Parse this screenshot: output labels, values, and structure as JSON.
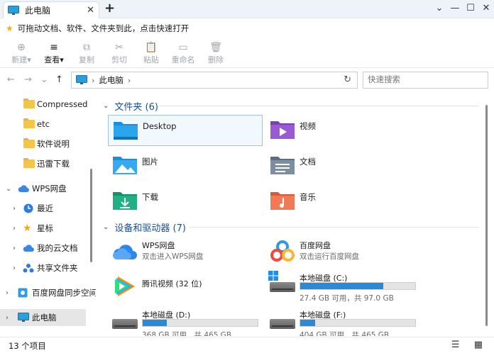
{
  "titlebar": {
    "tab_title": "此电脑",
    "close_glyph": "✕",
    "newtab_glyph": "+",
    "win_buttons": [
      "⌄",
      "—",
      "☐",
      "✕"
    ]
  },
  "tip": {
    "text": "可拖动文档、软件、文件夹到此，点击快速打开"
  },
  "toolbar": {
    "items": [
      {
        "label": "新建",
        "icon": "⊕",
        "suffix": "▾"
      },
      {
        "label": "查看",
        "icon": "≡",
        "suffix": "▾"
      },
      {
        "label": "复制",
        "icon": "⧉"
      },
      {
        "label": "剪切",
        "icon": "✂"
      },
      {
        "label": "粘贴",
        "icon": "📋"
      },
      {
        "label": "重命名",
        "icon": "▭"
      },
      {
        "label": "删除",
        "icon": "🗑"
      }
    ]
  },
  "nav": {
    "back": "←",
    "forward": "→",
    "history": "⌄",
    "up": "↑"
  },
  "address": {
    "crumb": "此电脑",
    "sep": "›",
    "refresh": "↻"
  },
  "search": {
    "placeholder": "快速搜索"
  },
  "sidebar": {
    "items": [
      {
        "label": "Compressed",
        "type": "folder"
      },
      {
        "label": "etc",
        "type": "folder"
      },
      {
        "label": "软件说明",
        "type": "folder"
      },
      {
        "label": "迅雷下载",
        "type": "folder"
      },
      {
        "label": "WPS网盘",
        "type": "cloud",
        "chev": "⌄"
      },
      {
        "label": "最近",
        "type": "clock",
        "chev": "›"
      },
      {
        "label": "星标",
        "type": "star",
        "chev": "›"
      },
      {
        "label": "我的云文档",
        "type": "cloud",
        "chev": "›"
      },
      {
        "label": "共享文件夹",
        "type": "share",
        "chev": "›"
      },
      {
        "label": "百度网盘同步空间",
        "type": "baidu",
        "chev": "›"
      },
      {
        "label": "此电脑",
        "type": "pc",
        "chev": "›"
      }
    ]
  },
  "folders_section": {
    "title": "文件夹 (6)",
    "chev": "⌄"
  },
  "folders": [
    {
      "label": "Desktop"
    },
    {
      "label": "视频"
    },
    {
      "label": "图片"
    },
    {
      "label": "文档"
    },
    {
      "label": "下载"
    },
    {
      "label": "音乐"
    }
  ],
  "devices_section": {
    "title": "设备和驱动器 (7)",
    "chev": "⌄"
  },
  "devices": [
    {
      "name": "WPS网盘",
      "sub": "双击进入WPS网盘"
    },
    {
      "name": "百度网盘",
      "sub": "双击运行百度网盘"
    },
    {
      "name": "腾讯视频 (32 位)"
    },
    {
      "name": "本地磁盘 (C:)",
      "usage": "27.4 GB 可用，共 97.0 GB",
      "used_fraction": 0.72
    },
    {
      "name": "本地磁盘 (D:)",
      "usage": "368 GB 可用，共 465 GB",
      "used_fraction": 0.21
    },
    {
      "name": "本地磁盘 (F:)",
      "usage": "404 GB 可用，共 465 GB",
      "used_fraction": 0.13
    }
  ],
  "status": {
    "count": "13 个项目",
    "views": "☰ ▦"
  },
  "colors": {
    "accent": "#1f4e8c",
    "drive_fill": "#2a8ad8",
    "folder_yellow": "#f5c547"
  }
}
